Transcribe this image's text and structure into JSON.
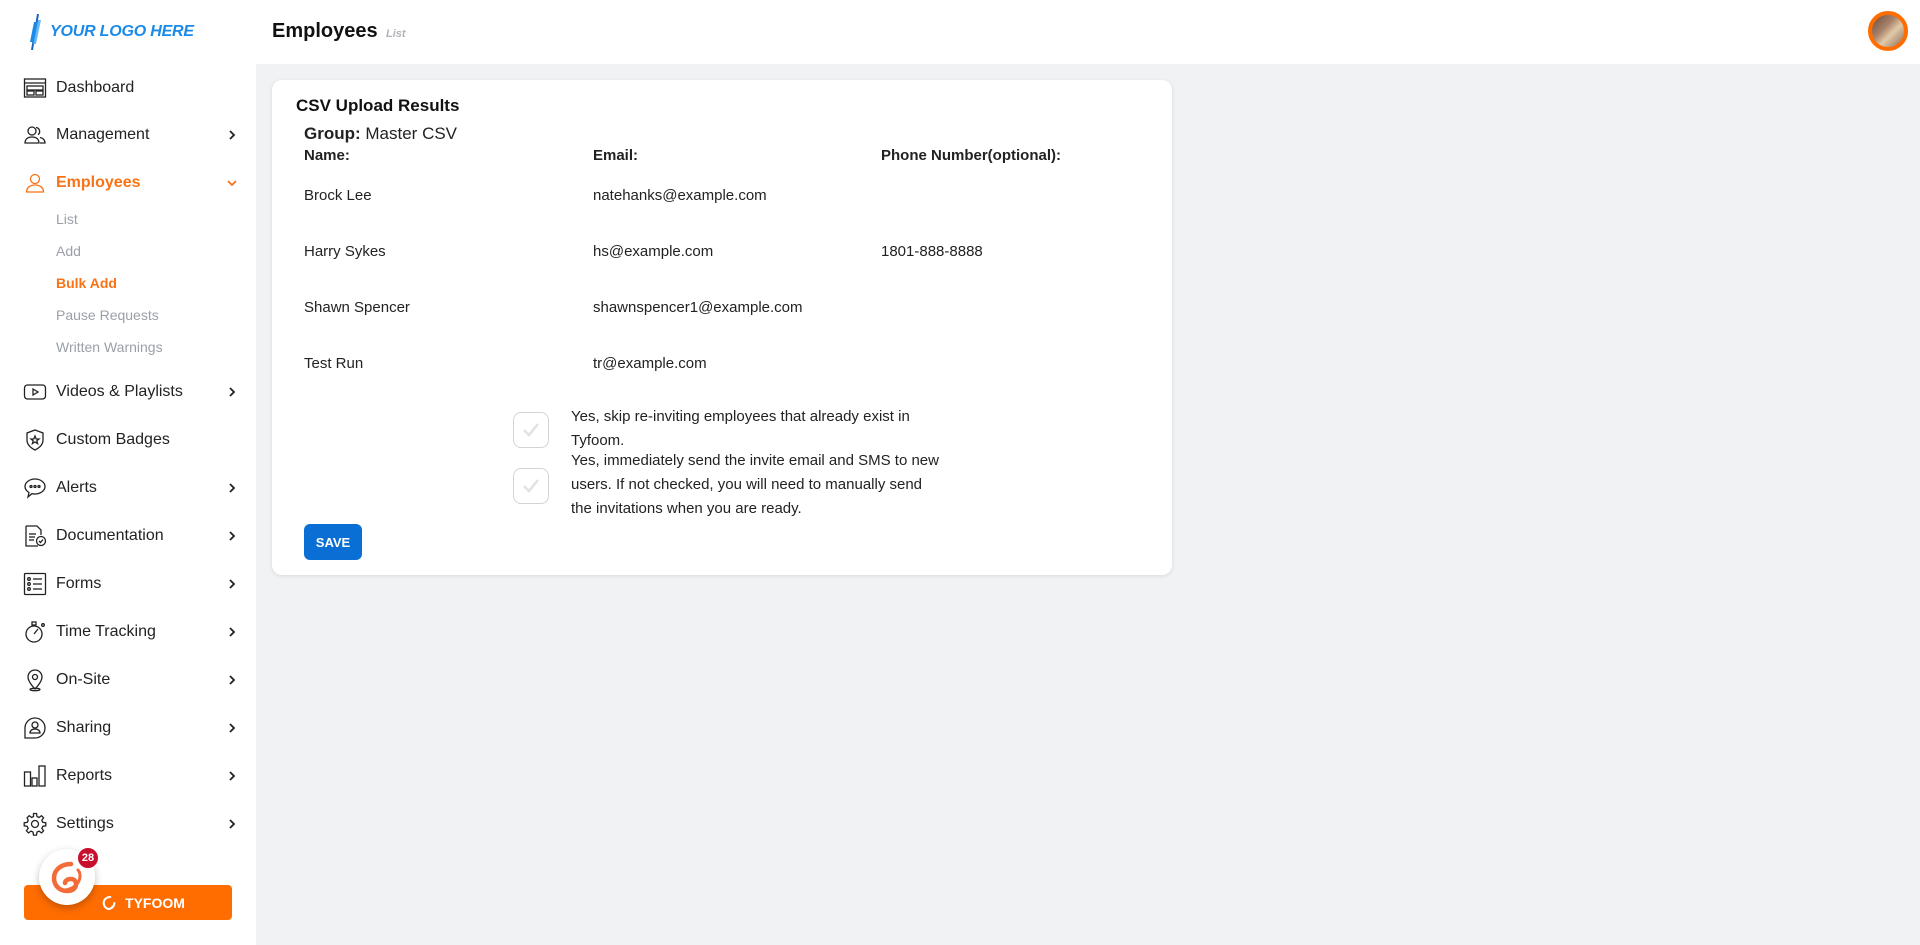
{
  "brand": {
    "logo_text": "YOUR LOGO HERE",
    "accent_color": "#f97316",
    "logo_color": "#1a8ae8"
  },
  "header": {
    "title": "Employees",
    "subtitle": "List"
  },
  "sidebar": {
    "items": [
      {
        "label": "Dashboard",
        "icon": "dashboard-icon",
        "has_chevron": false
      },
      {
        "label": "Management",
        "icon": "users-icon",
        "has_chevron": true
      },
      {
        "label": "Employees",
        "icon": "user-icon",
        "has_chevron": true,
        "expanded": true,
        "active": true
      },
      {
        "label": "Videos & Playlists",
        "icon": "video-icon",
        "has_chevron": true
      },
      {
        "label": "Custom Badges",
        "icon": "badge-icon",
        "has_chevron": false
      },
      {
        "label": "Alerts",
        "icon": "chat-bubble-icon",
        "has_chevron": true
      },
      {
        "label": "Documentation",
        "icon": "document-check-icon",
        "has_chevron": true
      },
      {
        "label": "Forms",
        "icon": "list-icon",
        "has_chevron": true
      },
      {
        "label": "Time Tracking",
        "icon": "stopwatch-icon",
        "has_chevron": true
      },
      {
        "label": "On-Site",
        "icon": "map-pin-icon",
        "has_chevron": true
      },
      {
        "label": "Sharing",
        "icon": "share-user-icon",
        "has_chevron": true
      },
      {
        "label": "Reports",
        "icon": "bar-chart-icon",
        "has_chevron": true
      },
      {
        "label": "Settings",
        "icon": "gear-icon",
        "has_chevron": true
      }
    ],
    "employees_subitems": [
      {
        "label": "List",
        "active": false
      },
      {
        "label": "Add",
        "active": false
      },
      {
        "label": "Bulk Add",
        "active": true
      },
      {
        "label": "Pause Requests",
        "active": false
      },
      {
        "label": "Written Warnings",
        "active": false
      }
    ],
    "tyfoom_button_label": "TYFOOM",
    "notification_count": "28"
  },
  "card": {
    "title": "CSV Upload Results",
    "group_label": "Group:",
    "group_value": "Master CSV",
    "columns": [
      "Name:",
      "Email:",
      "Phone Number(optional):"
    ],
    "rows": [
      {
        "name": "Brock Lee",
        "email": "natehanks@example.com",
        "phone": ""
      },
      {
        "name": "Harry Sykes",
        "email": "hs@example.com",
        "phone": "1801-888-8888"
      },
      {
        "name": "Shawn Spencer",
        "email": "shawnspencer1@example.com",
        "phone": ""
      },
      {
        "name": "Test Run",
        "email": "tr@example.com",
        "phone": ""
      }
    ],
    "options": [
      {
        "label": "Yes, skip re-inviting employees that already exist in Tyfoom.",
        "checked": false
      },
      {
        "label": "Yes, immediately send the invite email and SMS to new users. If not checked, you will need to manually send the invitations when you are ready.",
        "checked": false
      }
    ],
    "save_label": "SAVE"
  }
}
